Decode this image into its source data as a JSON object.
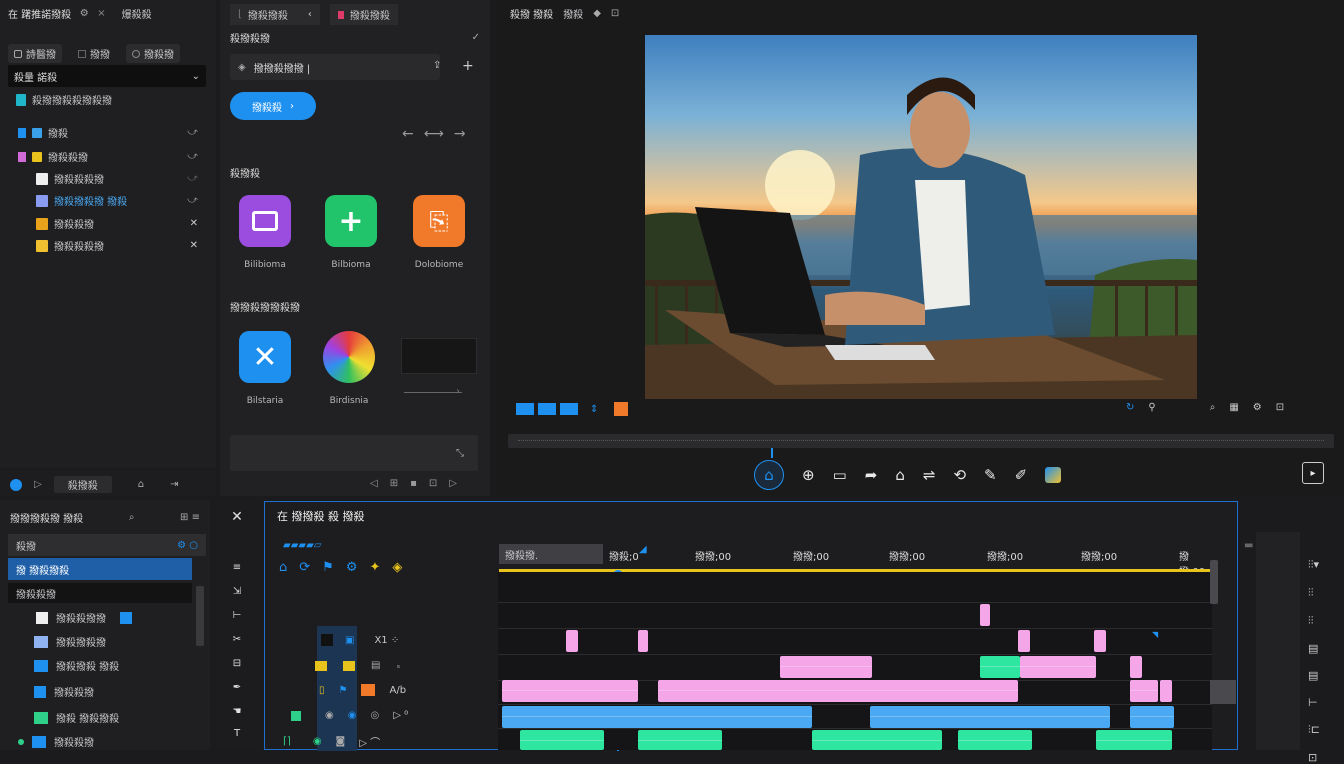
{
  "top_left": {
    "title": "在 躇推諾撥殺",
    "tab2": "爆殺殺"
  },
  "left_panel": {
    "tabs": [
      "詩醫撥",
      "撥撥",
      "撥殺撥"
    ],
    "dropdown": "殺量 諾殺",
    "list": [
      {
        "label": "殺撥撥殺殺撥殺撥"
      },
      {
        "label": "撥殺"
      },
      {
        "label": "撥殺殺撥"
      },
      {
        "label": "撥殺殺殺撥"
      },
      {
        "label": "撥殺撥殺撥 撥殺"
      },
      {
        "label": "撥殺殺撥"
      },
      {
        "label": "撥殺殺殺撥"
      }
    ],
    "footer_btn": "殺撥殺"
  },
  "mid_panel": {
    "tab_a": "撥殺撥殺",
    "tab_b": "撥殺撥殺",
    "section1": "殺撥殺撥",
    "field_text": "撥撥殺撥撥 |",
    "blue_button": "撥殺殺",
    "section2": "殺撥殺",
    "apps": [
      {
        "name": "Bilibioma",
        "color": "#9b4de0"
      },
      {
        "name": "Bilbioma",
        "color": "#21c46b"
      },
      {
        "name": "Dolobiome",
        "color": "#f07a2a"
      },
      {
        "name": "Bilstaria",
        "color": "#1e90f0"
      },
      {
        "name": "Birdisnia",
        "color": "rainbow"
      }
    ],
    "section3": "撥撥殺撥撥殺撥"
  },
  "viewer": {
    "title": "殺撥 撥殺",
    "tab": "撥殺"
  },
  "project": {
    "title": "撥撥撥殺撥 撥殺",
    "search": "殺撥",
    "items": [
      {
        "label": "撥 撥殺撥殺"
      },
      {
        "label": "撥殺殺撥"
      },
      {
        "label": "撥殺殺撥撥"
      },
      {
        "label": "撥殺撥殺撥"
      },
      {
        "label": "撥殺撥殺 撥殺"
      },
      {
        "label": "撥殺殺撥"
      },
      {
        "label": "撥殺 撥殺撥殺"
      },
      {
        "label": "撥殺殺撥"
      }
    ]
  },
  "timeline": {
    "title": "在 撥撥殺 殺 撥殺",
    "sequence_label": "撥殺撥.",
    "ruler": [
      "撥殺;0",
      "撥撥;00",
      "撥撥;00",
      "撥撥;00",
      "撥撥;00",
      "撥撥;00",
      "撥撥;00"
    ]
  },
  "colors": {
    "accent": "#1e90f0",
    "pink": "#f4a6e8",
    "blue": "#4aa9f2",
    "green": "#2fe6a0",
    "yellow": "#e8c31c"
  }
}
